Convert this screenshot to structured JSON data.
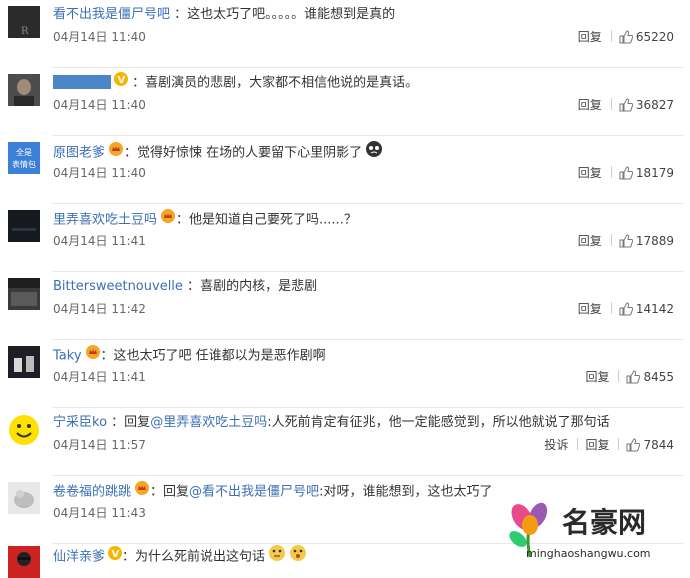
{
  "comments": [
    {
      "user": "看不出我是僵尸号吧",
      "sep": " ：",
      "text": "这也太巧了吧。。。。。谁能想到是真的",
      "time": "04月14日 11:40",
      "reply": "回复",
      "likes": "65220",
      "avatar_color": "#2b2b2b",
      "avatar_glyph": "R",
      "badge": null
    },
    {
      "user": "",
      "sep": " ：",
      "text": "喜剧演员的悲剧，大家都不相信他说的是真话。",
      "time": "04月14日 11:40",
      "reply": "回复",
      "likes": "36827",
      "avatar_color": "#4c4c4c",
      "avatar_glyph": "",
      "badge": "v",
      "name_redacted": true
    },
    {
      "user": "原图老爹",
      "sep": "：",
      "text": "觉得好惊悚 在场的人要留下心里阴影了",
      "time": "04月14日 11:40",
      "reply": "回复",
      "likes": "18179",
      "avatar_color": "#3b7fd6",
      "avatar_glyph": "全是 表情包",
      "badge": "crown",
      "emoji": "cry"
    },
    {
      "user": "里弄喜欢吃土豆吗",
      "sep": "：",
      "text": "他是知道自己要死了吗......？",
      "time": "04月14日 11:41",
      "reply": "回复",
      "likes": "17889",
      "avatar_color": "#161a20",
      "avatar_glyph": "",
      "badge": "crown"
    },
    {
      "user": "Bittersweetnouvelle",
      "sep": " ：",
      "text": "喜剧的内核，是悲剧",
      "time": "04月14日 11:42",
      "reply": "回复",
      "likes": "14142",
      "avatar_color": "#3a3a3a",
      "avatar_glyph": "",
      "badge": null
    },
    {
      "user": "Taky",
      "sep": "：",
      "text": "这也太巧了吧 任谁都以为是恶作剧啊",
      "time": "04月14日 11:41",
      "reply": "回复",
      "likes": "8455",
      "avatar_color": "#1e1e26",
      "avatar_glyph": "",
      "badge": "crown"
    },
    {
      "user": "宁采臣ko",
      "sep": " ：",
      "pre": "回复",
      "link": "@里弄喜欢吃土豆吗",
      "text": ":人死前肯定有征兆，他一定能感觉到，所以他就说了那句话",
      "time": "04月14日 11:57",
      "report": "投诉",
      "reply": "回复",
      "likes": "7844",
      "avatar_color": "#ffe000",
      "avatar_glyph": "smile",
      "badge": null
    },
    {
      "user": "卷卷福的跳跳",
      "sep": "：",
      "pre": "回复",
      "link": "@看不出我是僵尸号吧",
      "text": ":对呀，谁能想到，这也太巧了",
      "time": "04月14日 11:43",
      "reply": "",
      "likes": "",
      "avatar_color": "#e8e8e8",
      "avatar_glyph": "",
      "badge": "crown"
    },
    {
      "user": "仙洋亲爹",
      "sep": "：",
      "text": "为什么死前说出这句话",
      "time": "",
      "reply": "",
      "likes": "",
      "avatar_color": "#cc2222",
      "avatar_glyph": "",
      "badge": "v",
      "emoji": "thinking"
    }
  ],
  "watermark": {
    "title": "名豪网",
    "url": "minghaoshangwu.com"
  },
  "colors": {
    "link": "#3b6fb6",
    "text": "#333333",
    "meta": "#666666",
    "crown": "#f5a623",
    "v": "#f7b500"
  }
}
